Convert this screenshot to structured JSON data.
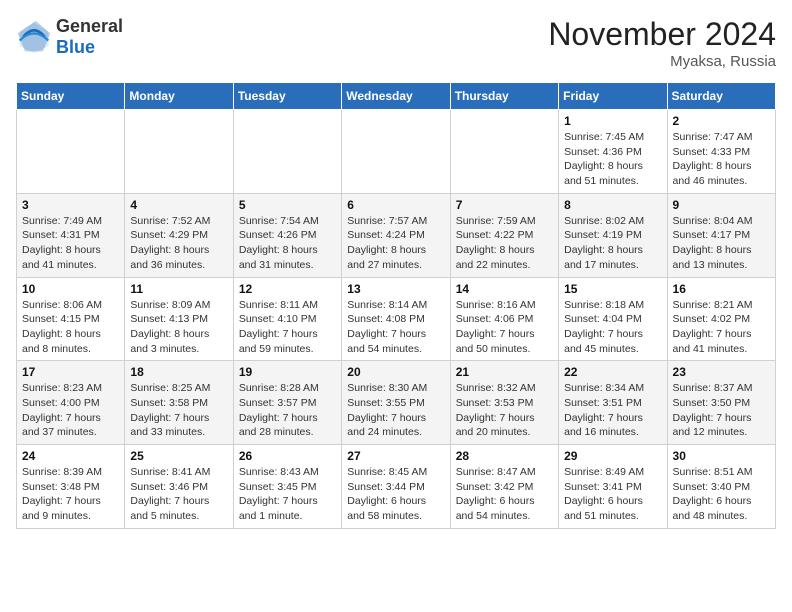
{
  "header": {
    "logo_general": "General",
    "logo_blue": "Blue",
    "month_title": "November 2024",
    "subtitle": "Myaksa, Russia"
  },
  "weekdays": [
    "Sunday",
    "Monday",
    "Tuesday",
    "Wednesday",
    "Thursday",
    "Friday",
    "Saturday"
  ],
  "weeks": [
    [
      {
        "day": "",
        "info": ""
      },
      {
        "day": "",
        "info": ""
      },
      {
        "day": "",
        "info": ""
      },
      {
        "day": "",
        "info": ""
      },
      {
        "day": "",
        "info": ""
      },
      {
        "day": "1",
        "info": "Sunrise: 7:45 AM\nSunset: 4:36 PM\nDaylight: 8 hours and 51 minutes."
      },
      {
        "day": "2",
        "info": "Sunrise: 7:47 AM\nSunset: 4:33 PM\nDaylight: 8 hours and 46 minutes."
      }
    ],
    [
      {
        "day": "3",
        "info": "Sunrise: 7:49 AM\nSunset: 4:31 PM\nDaylight: 8 hours and 41 minutes."
      },
      {
        "day": "4",
        "info": "Sunrise: 7:52 AM\nSunset: 4:29 PM\nDaylight: 8 hours and 36 minutes."
      },
      {
        "day": "5",
        "info": "Sunrise: 7:54 AM\nSunset: 4:26 PM\nDaylight: 8 hours and 31 minutes."
      },
      {
        "day": "6",
        "info": "Sunrise: 7:57 AM\nSunset: 4:24 PM\nDaylight: 8 hours and 27 minutes."
      },
      {
        "day": "7",
        "info": "Sunrise: 7:59 AM\nSunset: 4:22 PM\nDaylight: 8 hours and 22 minutes."
      },
      {
        "day": "8",
        "info": "Sunrise: 8:02 AM\nSunset: 4:19 PM\nDaylight: 8 hours and 17 minutes."
      },
      {
        "day": "9",
        "info": "Sunrise: 8:04 AM\nSunset: 4:17 PM\nDaylight: 8 hours and 13 minutes."
      }
    ],
    [
      {
        "day": "10",
        "info": "Sunrise: 8:06 AM\nSunset: 4:15 PM\nDaylight: 8 hours and 8 minutes."
      },
      {
        "day": "11",
        "info": "Sunrise: 8:09 AM\nSunset: 4:13 PM\nDaylight: 8 hours and 3 minutes."
      },
      {
        "day": "12",
        "info": "Sunrise: 8:11 AM\nSunset: 4:10 PM\nDaylight: 7 hours and 59 minutes."
      },
      {
        "day": "13",
        "info": "Sunrise: 8:14 AM\nSunset: 4:08 PM\nDaylight: 7 hours and 54 minutes."
      },
      {
        "day": "14",
        "info": "Sunrise: 8:16 AM\nSunset: 4:06 PM\nDaylight: 7 hours and 50 minutes."
      },
      {
        "day": "15",
        "info": "Sunrise: 8:18 AM\nSunset: 4:04 PM\nDaylight: 7 hours and 45 minutes."
      },
      {
        "day": "16",
        "info": "Sunrise: 8:21 AM\nSunset: 4:02 PM\nDaylight: 7 hours and 41 minutes."
      }
    ],
    [
      {
        "day": "17",
        "info": "Sunrise: 8:23 AM\nSunset: 4:00 PM\nDaylight: 7 hours and 37 minutes."
      },
      {
        "day": "18",
        "info": "Sunrise: 8:25 AM\nSunset: 3:58 PM\nDaylight: 7 hours and 33 minutes."
      },
      {
        "day": "19",
        "info": "Sunrise: 8:28 AM\nSunset: 3:57 PM\nDaylight: 7 hours and 28 minutes."
      },
      {
        "day": "20",
        "info": "Sunrise: 8:30 AM\nSunset: 3:55 PM\nDaylight: 7 hours and 24 minutes."
      },
      {
        "day": "21",
        "info": "Sunrise: 8:32 AM\nSunset: 3:53 PM\nDaylight: 7 hours and 20 minutes."
      },
      {
        "day": "22",
        "info": "Sunrise: 8:34 AM\nSunset: 3:51 PM\nDaylight: 7 hours and 16 minutes."
      },
      {
        "day": "23",
        "info": "Sunrise: 8:37 AM\nSunset: 3:50 PM\nDaylight: 7 hours and 12 minutes."
      }
    ],
    [
      {
        "day": "24",
        "info": "Sunrise: 8:39 AM\nSunset: 3:48 PM\nDaylight: 7 hours and 9 minutes."
      },
      {
        "day": "25",
        "info": "Sunrise: 8:41 AM\nSunset: 3:46 PM\nDaylight: 7 hours and 5 minutes."
      },
      {
        "day": "26",
        "info": "Sunrise: 8:43 AM\nSunset: 3:45 PM\nDaylight: 7 hours and 1 minute."
      },
      {
        "day": "27",
        "info": "Sunrise: 8:45 AM\nSunset: 3:44 PM\nDaylight: 6 hours and 58 minutes."
      },
      {
        "day": "28",
        "info": "Sunrise: 8:47 AM\nSunset: 3:42 PM\nDaylight: 6 hours and 54 minutes."
      },
      {
        "day": "29",
        "info": "Sunrise: 8:49 AM\nSunset: 3:41 PM\nDaylight: 6 hours and 51 minutes."
      },
      {
        "day": "30",
        "info": "Sunrise: 8:51 AM\nSunset: 3:40 PM\nDaylight: 6 hours and 48 minutes."
      }
    ]
  ]
}
